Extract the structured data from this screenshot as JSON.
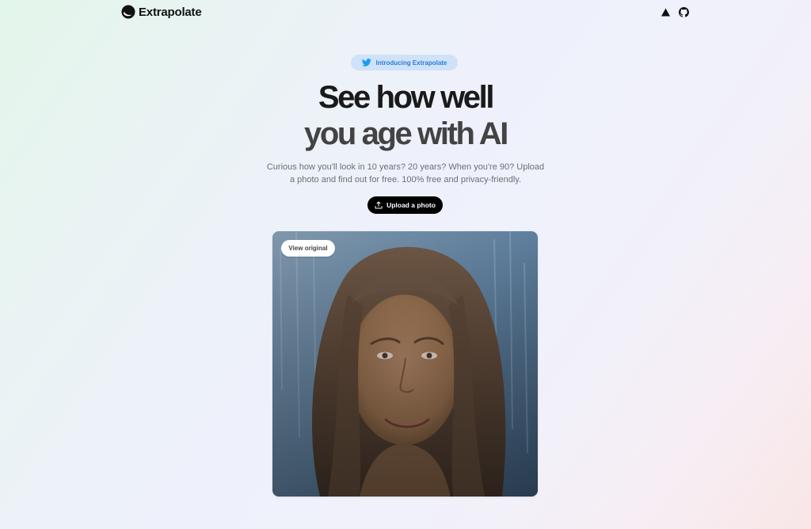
{
  "brand": {
    "name": "Extrapolate",
    "logo_icon": "extrapolate-logo-icon"
  },
  "nav": {
    "icons": [
      "vercel-triangle-icon",
      "github-icon"
    ]
  },
  "announcement": {
    "icon": "twitter-bird-icon",
    "label": "Introducing Extrapolate",
    "color": "#2d7bd3"
  },
  "hero": {
    "headline_line1": "See how well",
    "headline_line2": "you age with AI",
    "subtitle": "Curious how you'll look in 10 years? 20 years? When you're 90? Upload a photo and find out for free. 100% free and privacy-friendly.",
    "upload_button": {
      "icon": "upload-icon",
      "label": "Upload a photo"
    }
  },
  "photo": {
    "view_original_label": "View original"
  }
}
